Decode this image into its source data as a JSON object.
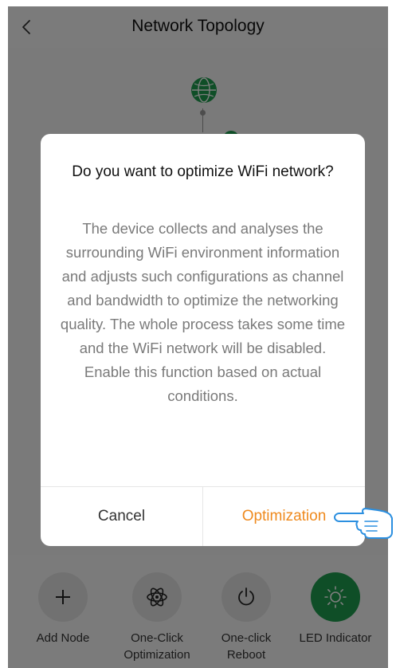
{
  "header": {
    "title": "Network Topology"
  },
  "dialog": {
    "title": "Do you want to optimize WiFi network?",
    "message": "The device collects and analyses the surrounding WiFi environment information and adjusts such configurations as channel and bandwidth to optimize the networking quality. The whole process takes some time and the WiFi network will be disabled. Enable this function based on actual conditions.",
    "cancel_label": "Cancel",
    "confirm_label": "Optimization"
  },
  "actions": [
    {
      "label": "Add Node",
      "icon": "plus-icon"
    },
    {
      "label": "One-Click\nOptimization",
      "icon": "atom-icon"
    },
    {
      "label": "One-click\nReboot",
      "icon": "power-icon"
    },
    {
      "label": "LED Indicator",
      "icon": "sun-icon"
    }
  ],
  "colors": {
    "accent_green": "#1e9c4e",
    "confirm_orange": "#ef8a1e"
  }
}
